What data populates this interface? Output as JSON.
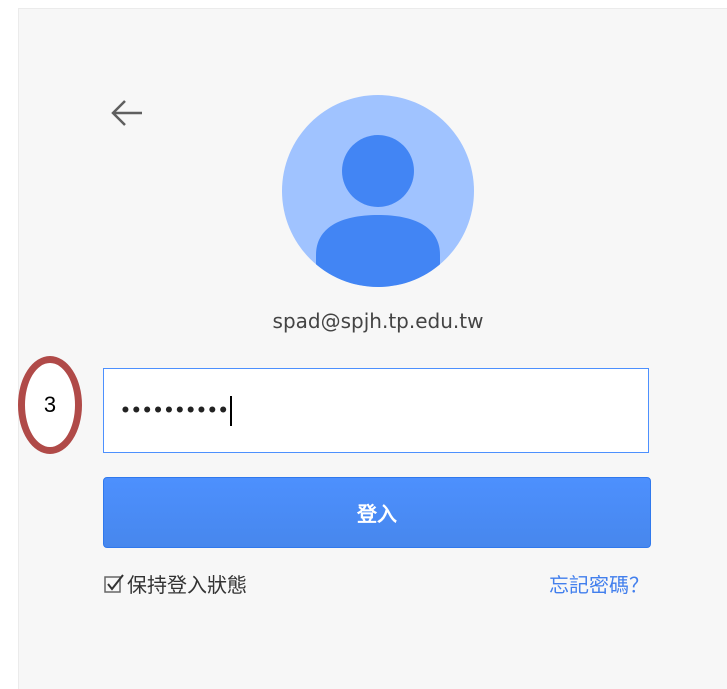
{
  "account": {
    "email": "spad@spjh.tp.edu.tw"
  },
  "password_field": {
    "masked_value": "••••••••••"
  },
  "signin": {
    "button_label": "登入"
  },
  "remember": {
    "label": "保持登入狀態",
    "checked": true
  },
  "forgot": {
    "label": "忘記密碼？"
  },
  "annotation": {
    "step_number": "3"
  },
  "icons": {
    "back": "back-arrow-icon",
    "avatar": "user-avatar-icon",
    "checkbox": "checkmark-icon"
  },
  "colors": {
    "accent": "#4d90fe",
    "link": "#427fed",
    "avatar_bg": "#a0c3ff",
    "avatar_fg": "#4285f4",
    "annotation_ring": "#b04a48"
  }
}
